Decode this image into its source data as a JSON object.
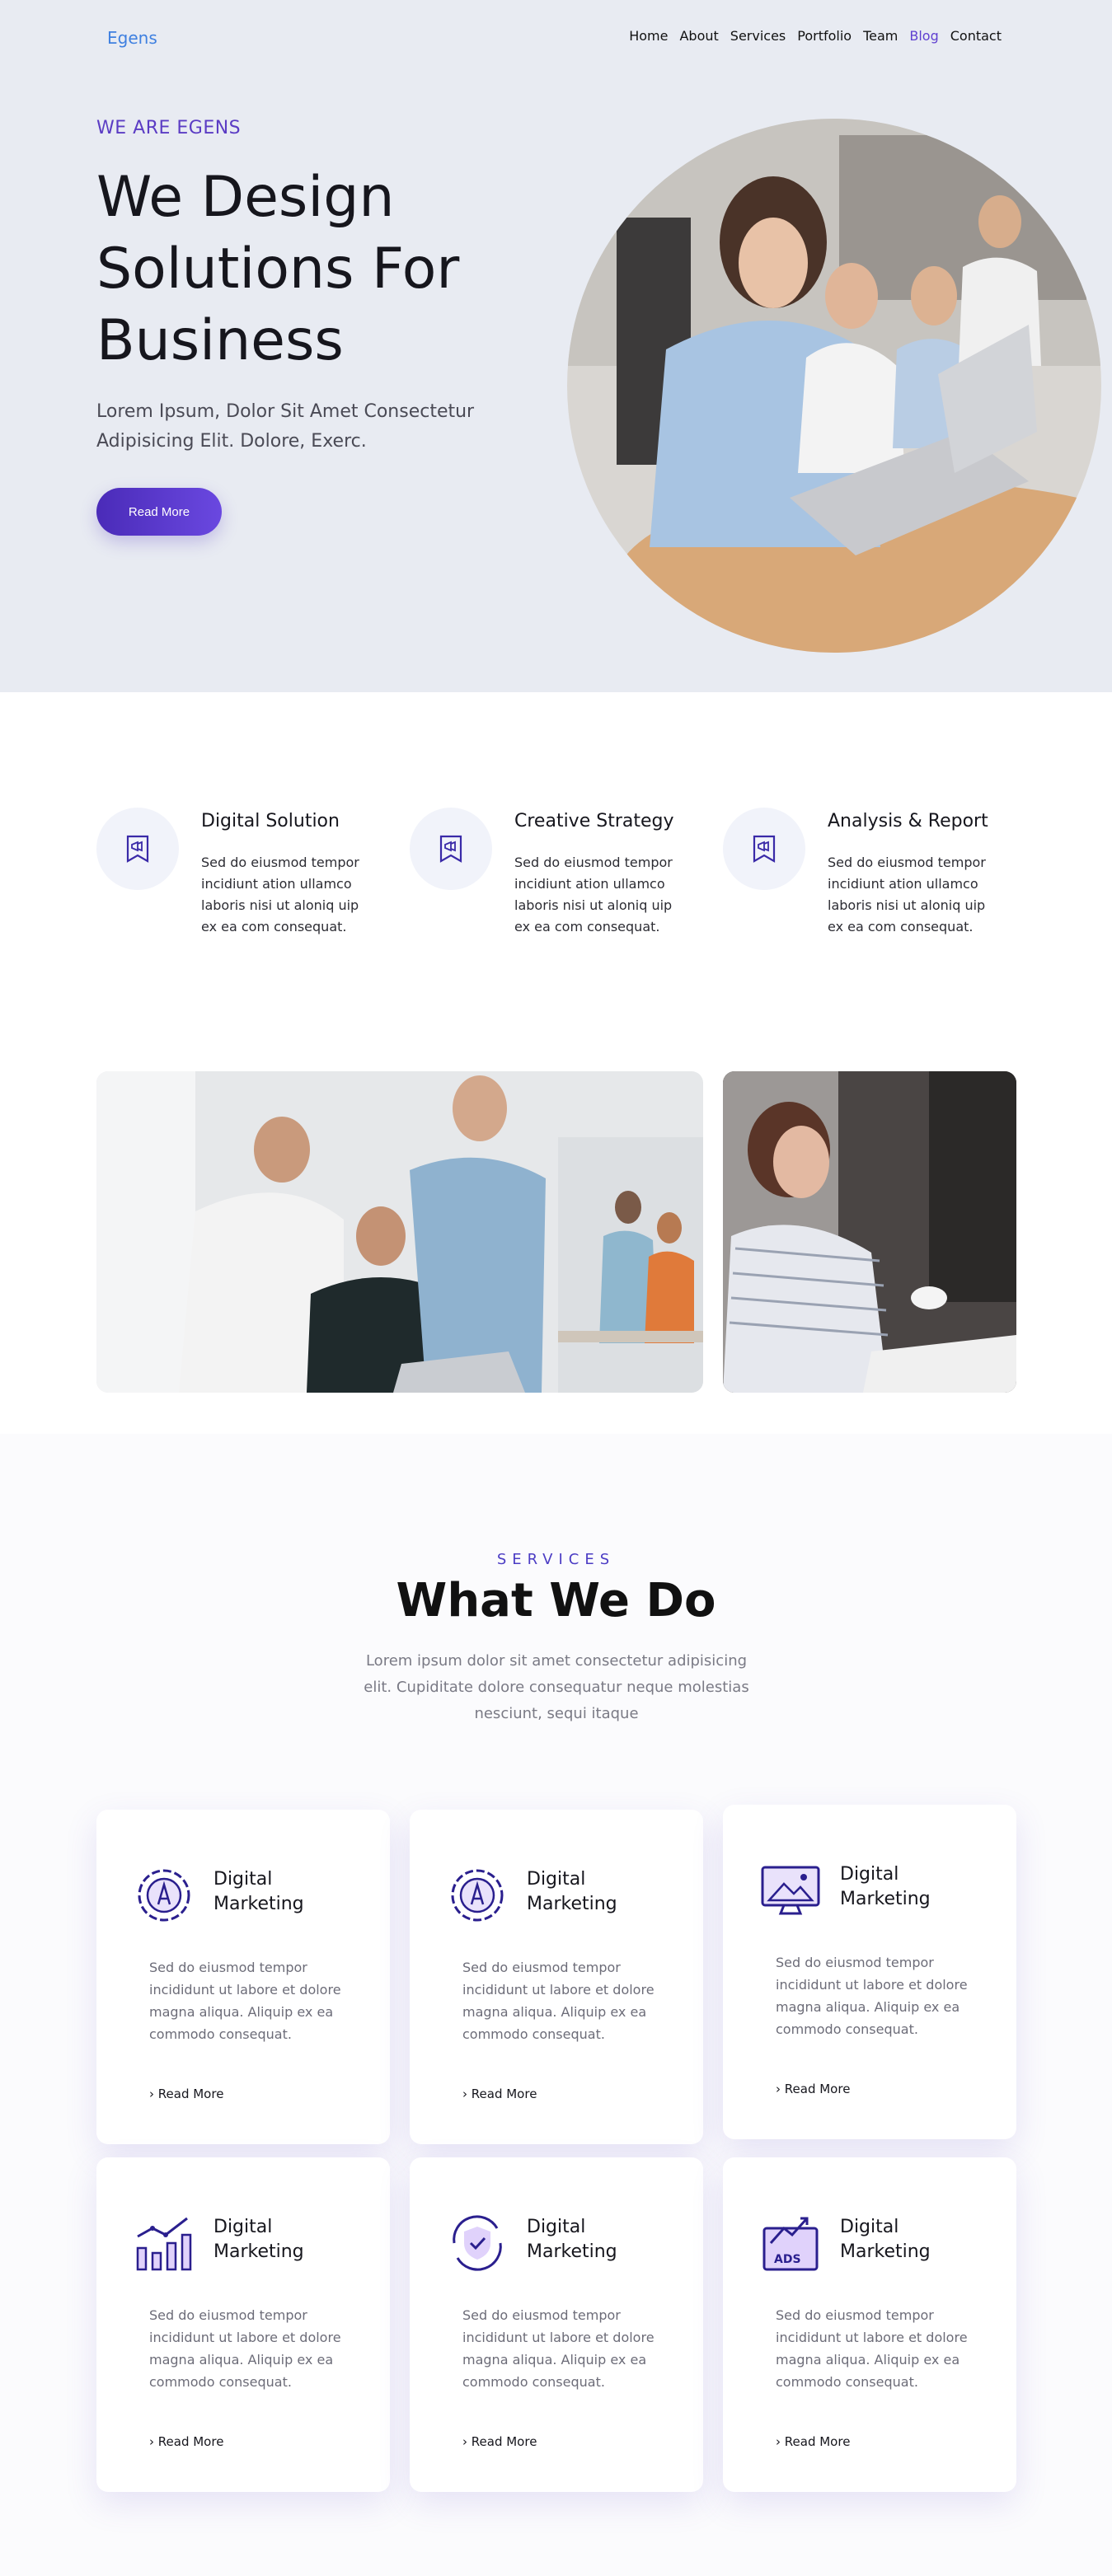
{
  "nav": {
    "logo": "Egens",
    "items": [
      {
        "label": "Home"
      },
      {
        "label": "About"
      },
      {
        "label": "Services"
      },
      {
        "label": "Portfolio"
      },
      {
        "label": "Team"
      },
      {
        "label": "Blog"
      },
      {
        "label": "Contact"
      }
    ]
  },
  "hero": {
    "eyebrow": "WE ARE EGENS",
    "title": "We Design Solutions For Business",
    "subtitle": "Lorem Ipsum, Dolor Sit Amet Consectetur Adipisicing Elit. Dolore, Exerc.",
    "button_label": "Read More"
  },
  "features": [
    {
      "title": "Digital Solution",
      "text": "Sed do eiusmod tempor incidiunt ation ullamco laboris nisi ut aloniq uip ex ea com consequat.",
      "icon": "megaphone-ribbon-icon"
    },
    {
      "title": "Creative Strategy",
      "text": "Sed do eiusmod tempor incidiunt ation ullamco laboris nisi ut aloniq uip ex ea com consequat.",
      "icon": "megaphone-ribbon-icon"
    },
    {
      "title": "Analysis & Report",
      "text": "Sed do eiusmod tempor incidiunt ation ullamco laboris nisi ut aloniq uip ex ea com consequat.",
      "icon": "megaphone-ribbon-icon"
    }
  ],
  "services": {
    "eyebrow": "SERVICES",
    "title": "What We Do",
    "subtitle": "Lorem ipsum dolor sit amet consectetur adipisicing elit. Cupiditate dolore consequatur neque molestias nesciunt, sequi itaque",
    "cards": [
      {
        "title": "Digital Marketing",
        "text": "Sed do eiusmod tempor incididunt ut labore et dolore magna aliqua. Aliquip ex ea commodo consequat.",
        "link": "Read More",
        "icon": "gear-pen-icon"
      },
      {
        "title": "Digital Marketing",
        "text": "Sed do eiusmod tempor incididunt ut labore et dolore magna aliqua. Aliquip ex ea commodo consequat.",
        "link": "Read More",
        "icon": "gear-pen-icon"
      },
      {
        "title": "Digital Marketing",
        "text": "Sed do eiusmod tempor incididunt ut labore et dolore magna aliqua. Aliquip ex ea commodo consequat.",
        "link": "Read More",
        "icon": "monitor-image-icon"
      },
      {
        "title": "Digital Marketing",
        "text": "Sed do eiusmod tempor incididunt ut labore et dolore magna aliqua. Aliquip ex ea commodo consequat.",
        "link": "Read More",
        "icon": "bar-chart-growth-icon"
      },
      {
        "title": "Digital Marketing",
        "text": "Sed do eiusmod tempor incididunt ut labore et dolore magna aliqua. Aliquip ex ea commodo consequat.",
        "link": "Read More",
        "icon": "shield-check-icon"
      },
      {
        "title": "Digital Marketing",
        "text": "Sed do eiusmod tempor incididunt ut labore et dolore magna aliqua. Aliquip ex ea commodo consequat.",
        "link": "Read More",
        "icon": "ads-growth-icon"
      }
    ]
  },
  "colors": {
    "accent": "#5b3cc4",
    "hero_background": "#e8ebf2",
    "logo": "#3f80e0"
  }
}
